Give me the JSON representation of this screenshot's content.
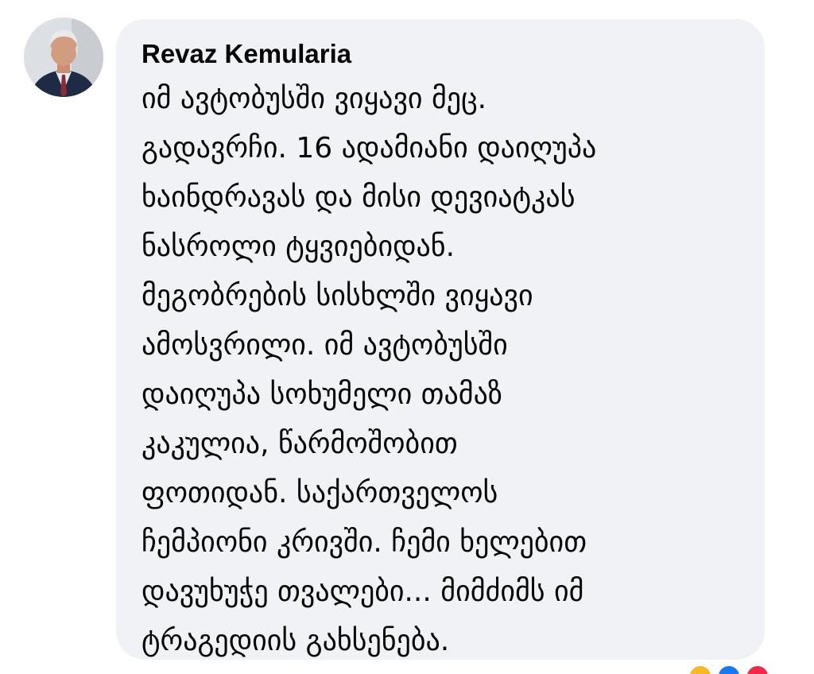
{
  "comment": {
    "author": "Revaz Kemularia",
    "lines": [
      "იმ ავტობუსში ვიყავი მეც.",
      "გადავრჩი. 16 ადამიანი დაიღუპა",
      "ხაინდრავას და მისი დევიატკას",
      "ნასროლი ტყვიებიდან.",
      "მეგობრების სისხლში ვიყავი",
      "ამოსვრილი. იმ ავტობუსში",
      "დაიღუპა სოხუმელი თამაზ",
      "კაკულია, წარმოშობით",
      "ფოთიდან. საქართველოს",
      "ჩემპიონი კრივში. ჩემი ხელებით",
      "დავუხუჭე თვალები... მიმძიმს იმ",
      "ტრაგედიის გახსენება."
    ]
  },
  "reactions": [
    {
      "icon": "haha-reaction-icon",
      "color": "#f7b928"
    },
    {
      "icon": "like-reaction-icon",
      "color": "#1877f2"
    },
    {
      "icon": "love-reaction-icon",
      "color": "#f0284a"
    }
  ]
}
